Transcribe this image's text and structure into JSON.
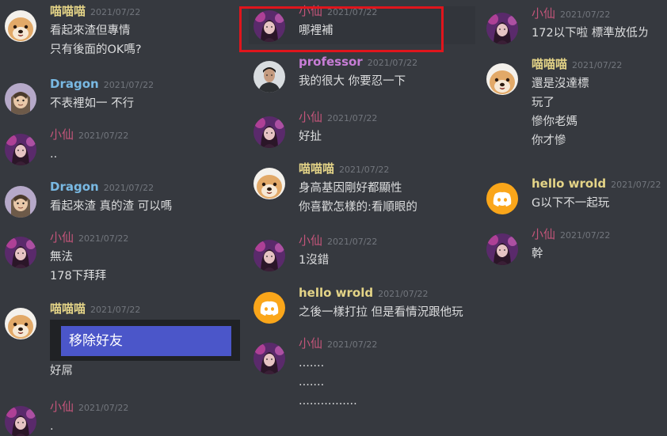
{
  "colors": {
    "bg": "#36393f",
    "pink": "#c3557a",
    "yellow": "#e4d487",
    "blue": "#79b9e3",
    "purple": "#c77dd6",
    "timestamp": "#72767d",
    "highlight": "#e0151c",
    "remove_button": "#4b56c9"
  },
  "columns": [
    {
      "messages": [
        {
          "author": "喵喵喵",
          "date": "2021/07/22",
          "color": "yellow",
          "avatar": "dog",
          "lines": [
            "看起來渣但專情",
            "只有後面的OK嗎?"
          ]
        },
        {
          "author": "Dragon",
          "date": "2021/07/22",
          "color": "blue",
          "avatar": "dragon",
          "lines": [
            "不表裡如一 不行"
          ]
        },
        {
          "author": "小仙",
          "date": "2021/07/22",
          "color": "pink",
          "avatar": "girl",
          "lines": [
            ".."
          ]
        },
        {
          "author": "Dragon",
          "date": "2021/07/22",
          "color": "blue",
          "avatar": "dragon",
          "lines": [
            "看起來渣 真的渣 可以嗎"
          ]
        },
        {
          "author": "小仙",
          "date": "2021/07/22",
          "color": "pink",
          "avatar": "girl",
          "lines": [
            "無法",
            "178下拜拜"
          ]
        },
        {
          "author": "喵喵喵",
          "date": "2021/07/22",
          "color": "yellow",
          "avatar": "dog",
          "embed_button": "移除好友",
          "lines": [
            "好屌"
          ]
        },
        {
          "author": "小仙",
          "date": "2021/07/22",
          "color": "pink",
          "avatar": "girl",
          "lines": [
            "."
          ]
        }
      ]
    },
    {
      "messages": [
        {
          "author": "小仙",
          "date": "2021/07/22",
          "color": "pink",
          "avatar": "girl",
          "lines": [
            "哪裡補"
          ]
        },
        {
          "author": "professor",
          "date": "2021/07/22",
          "color": "purple",
          "avatar": "man",
          "lines": [
            "我的很大 你要忍一下"
          ]
        },
        {
          "author": "小仙",
          "date": "2021/07/22",
          "color": "pink",
          "avatar": "girl",
          "lines": [
            "好扯"
          ]
        },
        {
          "author": "喵喵喵",
          "date": "2021/07/22",
          "color": "yellow",
          "avatar": "dog",
          "lines": [
            "身高基因剛好都顯性",
            "你喜歡怎樣的:看順眼的"
          ]
        },
        {
          "author": "小仙",
          "date": "2021/07/22",
          "color": "pink",
          "avatar": "girl",
          "lines": [
            "1沒錯"
          ]
        },
        {
          "author": "hello wrold",
          "date": "2021/07/22",
          "color": "yellow",
          "avatar": "discord",
          "lines": [
            "之後一樣打拉 但是看情況跟他玩"
          ]
        },
        {
          "author": "小仙",
          "date": "2021/07/22",
          "color": "pink",
          "avatar": "girl",
          "lines": [
            ".......",
            ".......",
            "................"
          ]
        }
      ]
    },
    {
      "messages": [
        {
          "author": "小仙",
          "date": "2021/07/22",
          "color": "pink",
          "avatar": "girl",
          "lines": [
            "172以下啦 標準放低ㄌ"
          ]
        },
        {
          "author": "喵喵喵",
          "date": "2021/07/22",
          "color": "yellow",
          "avatar": "dog",
          "lines": [
            "還是沒達標",
            "玩了",
            "慘你老媽",
            "你才慘"
          ]
        },
        {
          "author": "hello wrold",
          "date": "2021/07/22",
          "color": "yellow",
          "avatar": "discord",
          "lines": [
            "G以下不一起玩"
          ]
        },
        {
          "author": "小仙",
          "date": "2021/07/22",
          "color": "pink",
          "avatar": "girl",
          "lines": [
            "幹"
          ]
        }
      ]
    }
  ]
}
